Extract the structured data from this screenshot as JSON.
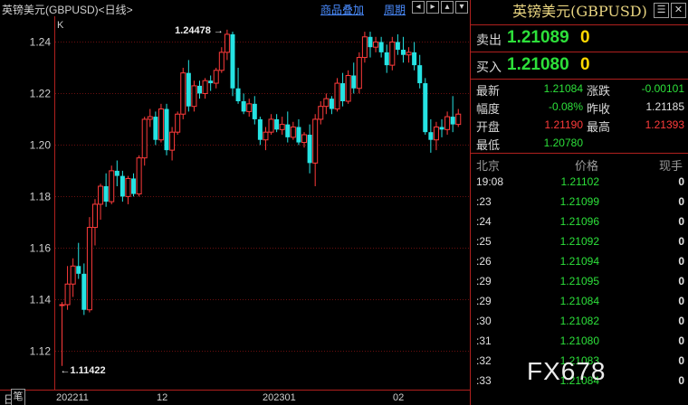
{
  "chart_header": {
    "title": "英镑美元(GBPUSD)<日线>",
    "btn_overlay": "商品叠加",
    "btn_period": "周期",
    "icons": [
      "arrow-left-icon",
      "arrow-right-icon",
      "arrow-up-icon",
      "arrow-down-icon"
    ]
  },
  "chart_k_label": "K",
  "x_axis": {
    "title": "日线",
    "ticks": [
      "202211",
      "12",
      "202301",
      "02"
    ]
  },
  "colors": {
    "up": "#ff3b3b",
    "down": "#25e3e3",
    "grid": "#6a0f0f",
    "axis": "#b0201e",
    "price_up": "#ff3b3b",
    "price_down": "#2de03a",
    "title": "#e8d480",
    "link": "#4a8cff"
  },
  "chart_data": {
    "type": "candlestick",
    "ylim": [
      1.105,
      1.25
    ],
    "y_ticks": [
      1.12,
      1.14,
      1.16,
      1.18,
      1.2,
      1.22,
      1.24
    ],
    "y_tick_labels": [
      "1.12",
      "1.14",
      "1.16",
      "1.18",
      "1.20",
      "1.22",
      "1.24"
    ],
    "annotations": [
      {
        "text": "1.24478",
        "type": "high_marker"
      },
      {
        "text": "1.11422",
        "type": "low_marker"
      }
    ],
    "candles": [
      [
        1.138,
        1.139,
        1.1142,
        1.138
      ],
      [
        1.138,
        1.153,
        1.136,
        1.146
      ],
      [
        1.146,
        1.156,
        1.141,
        1.153
      ],
      [
        1.153,
        1.162,
        1.148,
        1.15
      ],
      [
        1.15,
        1.154,
        1.134,
        1.136
      ],
      [
        1.136,
        1.172,
        1.135,
        1.168
      ],
      [
        1.168,
        1.179,
        1.161,
        1.177
      ],
      [
        1.177,
        1.185,
        1.171,
        1.184
      ],
      [
        1.184,
        1.189,
        1.176,
        1.178
      ],
      [
        1.178,
        1.192,
        1.177,
        1.19
      ],
      [
        1.19,
        1.194,
        1.184,
        1.188
      ],
      [
        1.188,
        1.19,
        1.178,
        1.18
      ],
      [
        1.18,
        1.188,
        1.177,
        1.187
      ],
      [
        1.187,
        1.189,
        1.18,
        1.181
      ],
      [
        1.181,
        1.196,
        1.18,
        1.195
      ],
      [
        1.195,
        1.211,
        1.192,
        1.21
      ],
      [
        1.21,
        1.214,
        1.207,
        1.211
      ],
      [
        1.211,
        1.213,
        1.2,
        1.202
      ],
      [
        1.202,
        1.216,
        1.201,
        1.214
      ],
      [
        1.214,
        1.216,
        1.196,
        1.198
      ],
      [
        1.198,
        1.207,
        1.194,
        1.205
      ],
      [
        1.205,
        1.213,
        1.204,
        1.212
      ],
      [
        1.212,
        1.23,
        1.21,
        1.228
      ],
      [
        1.228,
        1.233,
        1.213,
        1.215
      ],
      [
        1.215,
        1.225,
        1.213,
        1.223
      ],
      [
        1.223,
        1.225,
        1.218,
        1.22
      ],
      [
        1.22,
        1.226,
        1.218,
        1.225
      ],
      [
        1.225,
        1.227,
        1.221,
        1.224
      ],
      [
        1.224,
        1.23,
        1.222,
        1.229
      ],
      [
        1.229,
        1.238,
        1.228,
        1.236
      ],
      [
        1.236,
        1.2448,
        1.233,
        1.243
      ],
      [
        1.243,
        1.244,
        1.219,
        1.222
      ],
      [
        1.222,
        1.23,
        1.216,
        1.217
      ],
      [
        1.217,
        1.22,
        1.212,
        1.213
      ],
      [
        1.213,
        1.218,
        1.211,
        1.216
      ],
      [
        1.216,
        1.219,
        1.208,
        1.21
      ],
      [
        1.21,
        1.211,
        1.2,
        1.202
      ],
      [
        1.202,
        1.207,
        1.198,
        1.205
      ],
      [
        1.205,
        1.212,
        1.204,
        1.21
      ],
      [
        1.21,
        1.212,
        1.205,
        1.206
      ],
      [
        1.206,
        1.211,
        1.204,
        1.208
      ],
      [
        1.208,
        1.213,
        1.201,
        1.203
      ],
      [
        1.203,
        1.209,
        1.202,
        1.207
      ],
      [
        1.207,
        1.21,
        1.2,
        1.201
      ],
      [
        1.201,
        1.205,
        1.199,
        1.204
      ],
      [
        1.204,
        1.208,
        1.189,
        1.193
      ],
      [
        1.193,
        1.212,
        1.184,
        1.21
      ],
      [
        1.21,
        1.217,
        1.208,
        1.215
      ],
      [
        1.215,
        1.22,
        1.212,
        1.218
      ],
      [
        1.218,
        1.219,
        1.212,
        1.214
      ],
      [
        1.214,
        1.226,
        1.213,
        1.224
      ],
      [
        1.224,
        1.228,
        1.215,
        1.217
      ],
      [
        1.217,
        1.229,
        1.216,
        1.227
      ],
      [
        1.227,
        1.232,
        1.22,
        1.222
      ],
      [
        1.222,
        1.236,
        1.22,
        1.234
      ],
      [
        1.234,
        1.244,
        1.232,
        1.242
      ],
      [
        1.242,
        1.244,
        1.234,
        1.238
      ],
      [
        1.238,
        1.242,
        1.236,
        1.24
      ],
      [
        1.24,
        1.242,
        1.234,
        1.236
      ],
      [
        1.236,
        1.239,
        1.228,
        1.231
      ],
      [
        1.231,
        1.242,
        1.229,
        1.24
      ],
      [
        1.24,
        1.243,
        1.235,
        1.237
      ],
      [
        1.237,
        1.242,
        1.232,
        1.235
      ],
      [
        1.235,
        1.238,
        1.232,
        1.236
      ],
      [
        1.236,
        1.24,
        1.229,
        1.231
      ],
      [
        1.231,
        1.235,
        1.222,
        1.224
      ],
      [
        1.224,
        1.226,
        1.204,
        1.205
      ],
      [
        1.205,
        1.21,
        1.197,
        1.202
      ],
      [
        1.202,
        1.209,
        1.198,
        1.207
      ],
      [
        1.207,
        1.21,
        1.203,
        1.206
      ],
      [
        1.206,
        1.213,
        1.204,
        1.211
      ],
      [
        1.211,
        1.219,
        1.205,
        1.208
      ],
      [
        1.208,
        1.214,
        1.207,
        1.212
      ]
    ]
  },
  "quote": {
    "title": "英镑美元(GBPUSD)",
    "sell_label": "卖出",
    "sell_price": "1.21089",
    "sell_vol": "0",
    "buy_label": "买入",
    "buy_price": "1.21080",
    "buy_vol": "0",
    "latest_label": "最新",
    "latest": "1.21084",
    "change_label": "涨跌",
    "change": "-0.00101",
    "pct_label": "幅度",
    "pct": "-0.08%",
    "prev_label": "昨收",
    "prev": "1.21185",
    "open_label": "开盘",
    "open": "1.21190",
    "high_label": "最高",
    "high": "1.21393",
    "low_label": "最低",
    "low": "1.20780"
  },
  "ticks_header": {
    "time": "北京",
    "price": "价格",
    "vol": "现手"
  },
  "ticks": [
    {
      "time": "19:08",
      "price": "1.21102",
      "vol": "0"
    },
    {
      "time": ":23",
      "price": "1.21099",
      "vol": "0"
    },
    {
      "time": ":24",
      "price": "1.21096",
      "vol": "0"
    },
    {
      "time": ":25",
      "price": "1.21092",
      "vol": "0"
    },
    {
      "time": ":26",
      "price": "1.21094",
      "vol": "0"
    },
    {
      "time": ":29",
      "price": "1.21095",
      "vol": "0"
    },
    {
      "time": ":29",
      "price": "1.21084",
      "vol": "0"
    },
    {
      "time": ":30",
      "price": "1.21082",
      "vol": "0"
    },
    {
      "time": ":31",
      "price": "1.21080",
      "vol": "0"
    },
    {
      "time": ":32",
      "price": "1.21083",
      "vol": "0"
    },
    {
      "time": ":33",
      "price": "1.21084",
      "vol": "0"
    }
  ],
  "bottom_tab": "笔",
  "watermark": "FX678"
}
